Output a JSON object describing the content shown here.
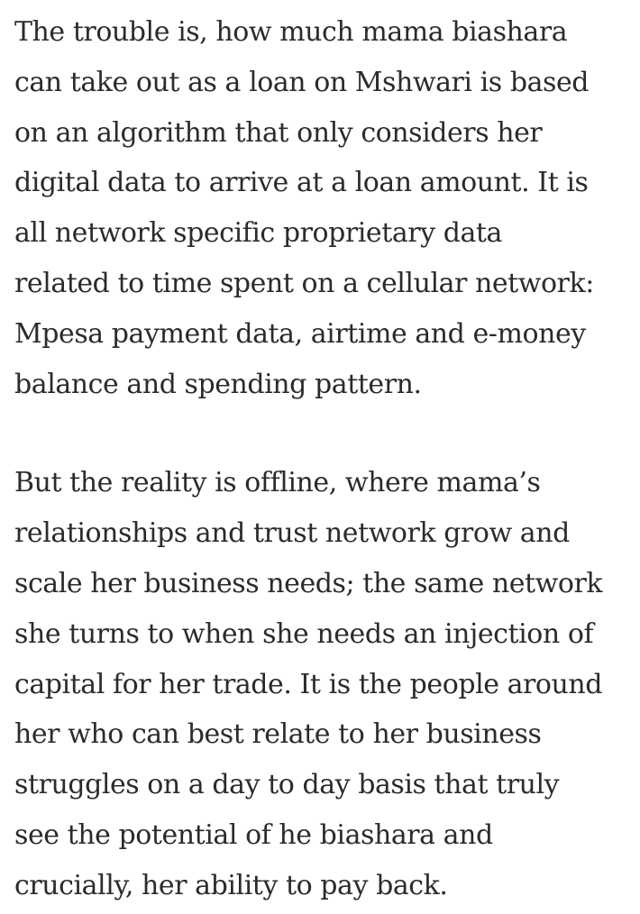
{
  "article": {
    "paragraphs": [
      {
        "lines": [
          "The trouble is, how much mama biashara",
          "can take out as a loan on Mshwari is based",
          "on an algorithm that only considers her",
          "digital data to arrive at a loan amount. It is",
          "all network specific proprietary data",
          "related to time spent on a cellular network:",
          "Mpesa payment data, airtime and e-money",
          "balance and spending pattern."
        ]
      },
      {
        "lines": [
          "But the reality is offline, where mama’s",
          "relationships and trust network grow and",
          "scale her business needs; the same network",
          "she turns to when she needs an injection of",
          "capital for her trade. It is the people around",
          "her who can best relate to her business",
          "struggles on a day to day basis that truly",
          "see the potential of he biashara and",
          "crucially, her ability to pay back."
        ]
      }
    ]
  }
}
